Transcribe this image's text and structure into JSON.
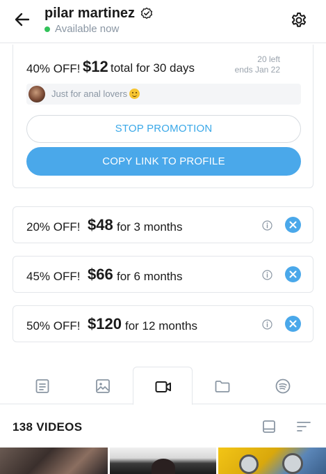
{
  "header": {
    "profile_name": "pilar martinez",
    "status": "Available now"
  },
  "promotion": {
    "discount": "40% OFF!",
    "price": "$12",
    "term": "total for 30 days",
    "remaining": "20 left",
    "ends": "ends Jan 22",
    "message": "Just for anal lovers",
    "stop_label": "STOP PROMOTION",
    "copy_label": "COPY LINK TO PROFILE"
  },
  "bundles": [
    {
      "discount": "20% OFF!",
      "price": "$48",
      "term": "for 3 months"
    },
    {
      "discount": "45% OFF!",
      "price": "$66",
      "term": "for 6 months"
    },
    {
      "discount": "50% OFF!",
      "price": "$120",
      "term": "for 12 months"
    }
  ],
  "tabs": [
    {
      "icon": "posts-icon",
      "active": false
    },
    {
      "icon": "photos-icon",
      "active": false
    },
    {
      "icon": "videos-icon",
      "active": true
    },
    {
      "icon": "folders-icon",
      "active": false
    },
    {
      "icon": "streams-icon",
      "active": false
    }
  ],
  "media": {
    "count_label": "138 VIDEOS"
  },
  "colors": {
    "accent": "#4aa8ea",
    "online": "#32c25a",
    "muted_text": "#8a96a3",
    "border": "#e3e6ea"
  }
}
